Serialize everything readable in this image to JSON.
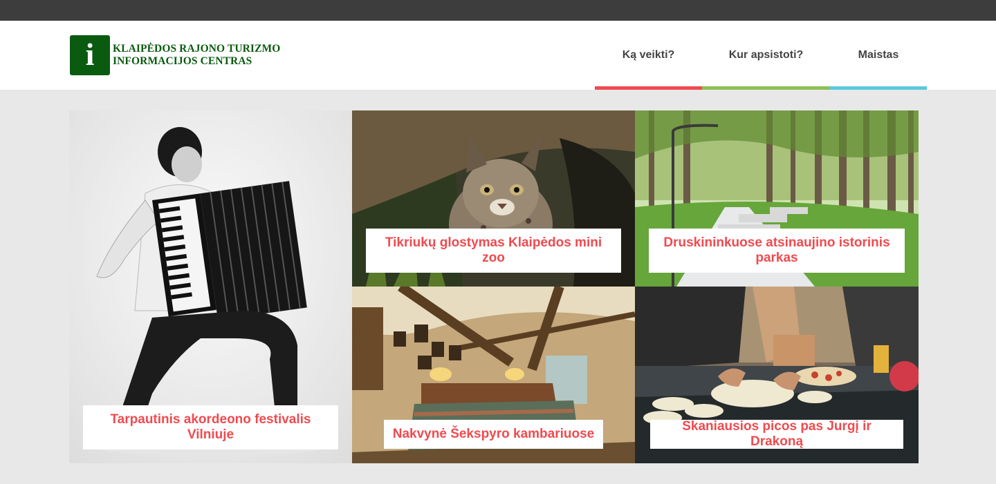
{
  "logo": {
    "glyph": "i",
    "line1": "KLAIPĖDOS RAJONO TURIZMO",
    "line2": "INFORMACIJOS CENTRAS",
    "color": "#0a5a0f"
  },
  "nav": [
    {
      "label": "Ką veikti?",
      "accent": "#f04a4f"
    },
    {
      "label": "Kur apsistoti?",
      "accent": "#8cc152"
    },
    {
      "label": "Maistas",
      "accent": "#5bc8dc"
    }
  ],
  "tiles": [
    {
      "title": "Tarpautinis akordeono festivalis Vilniuje",
      "image": "accordion-player-photo"
    },
    {
      "title": "Tikriukų glostymas Klaipėdos mini zoo",
      "image": "lynx-kitten-photo"
    },
    {
      "title": "Druskininkuose atsinaujino istorinis parkas",
      "image": "pine-park-path-photo"
    },
    {
      "title": "Nakvynė Šekspyro kambariuose",
      "image": "hotel-bedroom-photo"
    },
    {
      "title": "Skaniausios picos pas Jurgį ir Drakoną",
      "image": "pizza-making-photo"
    }
  ]
}
